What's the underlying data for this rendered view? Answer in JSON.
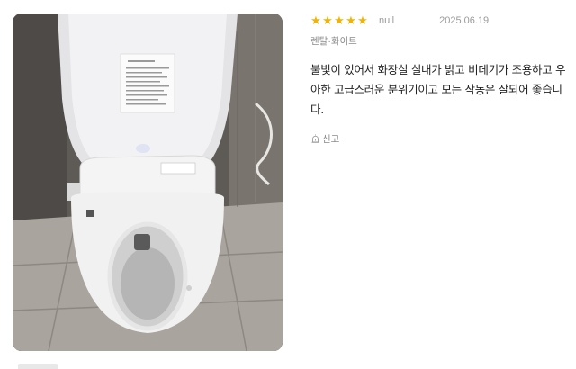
{
  "review": {
    "rating": 5,
    "stars": [
      "★",
      "★",
      "★",
      "★",
      "★"
    ],
    "author": "null",
    "date": "2025.06.19",
    "option": "렌탈·화이트",
    "text": "불빛이 있어서 화장실 실내가 밝고 비데기가 조용하고 우아한 고급스러운 분위기이고 모든 작동은 잘되어 좋습니다.",
    "report_label": "신고",
    "report_icon": "siren-icon"
  },
  "colors": {
    "star": "#f5b301",
    "muted": "#9a9a9a",
    "text": "#222222"
  }
}
